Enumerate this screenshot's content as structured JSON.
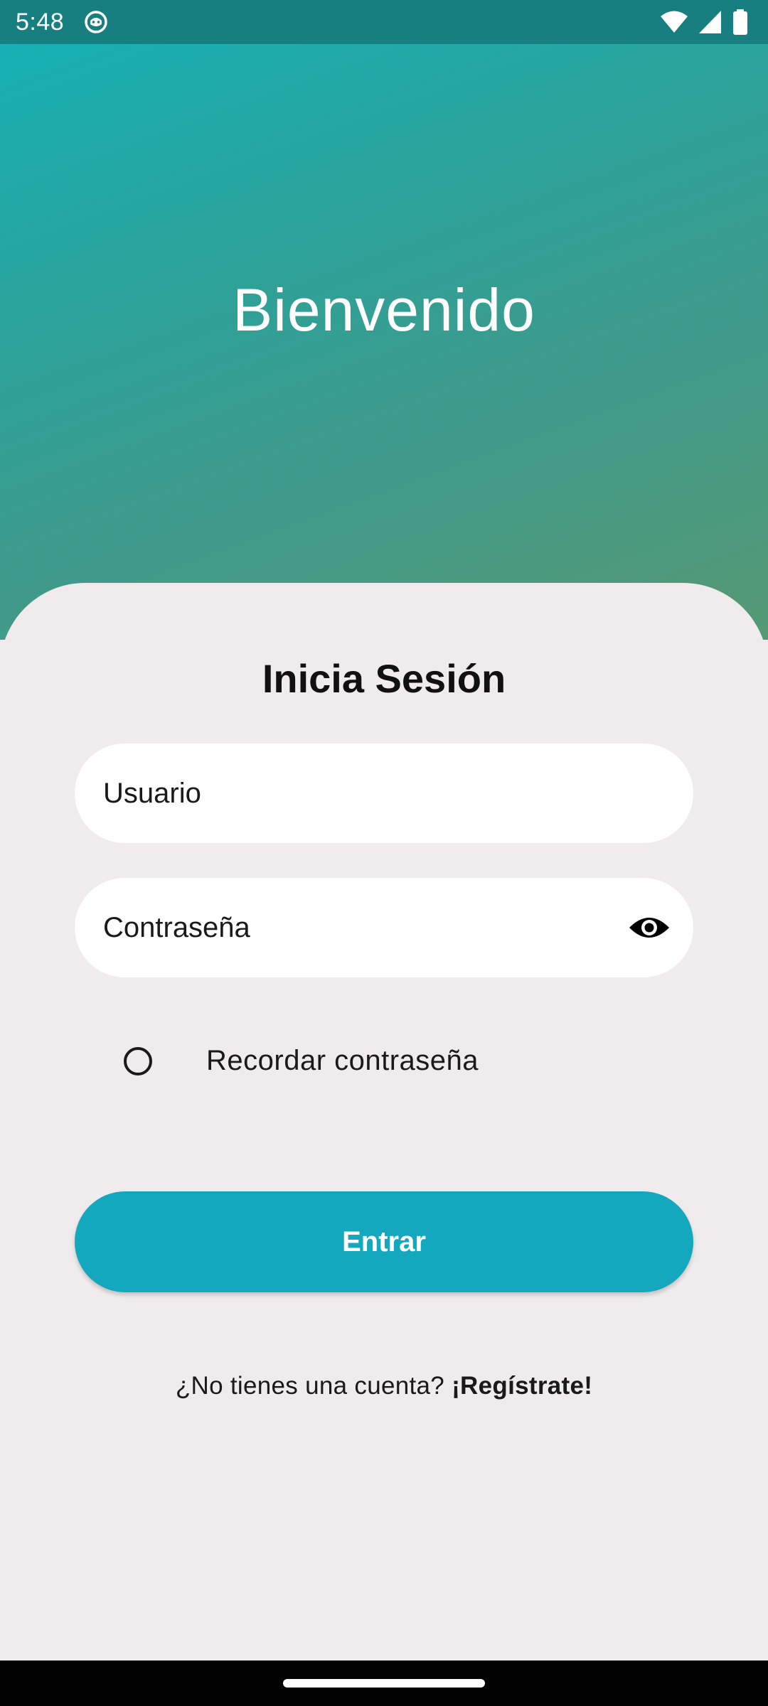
{
  "status_bar": {
    "time": "5:48",
    "icons": [
      "app-notification-icon",
      "wifi-icon",
      "cellular-signal-icon",
      "battery-icon"
    ]
  },
  "hero": {
    "title": "Bienvenido"
  },
  "login": {
    "title": "Inicia Sesión",
    "username_placeholder": "Usuario",
    "username_value": "",
    "password_placeholder": "Contraseña",
    "password_value": "",
    "password_toggle_icon": "eye-icon",
    "remember_label": "Recordar contraseña",
    "remember_checked": false,
    "submit_label": "Entrar",
    "signup_prompt": "¿No tienes una cuenta?",
    "signup_link": "¡Regístrate!"
  },
  "colors": {
    "gradient_start": "#15b3b9",
    "gradient_end": "#569974",
    "status_bar": "#187f80",
    "button": "#13a8bd",
    "sheet_background": "#f0ebec"
  }
}
